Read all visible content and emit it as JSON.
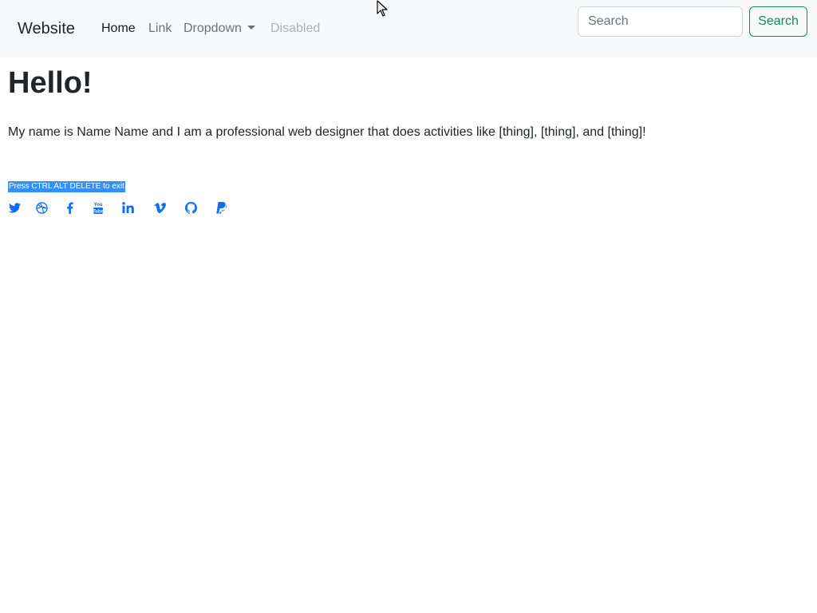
{
  "navbar": {
    "brand": "Website",
    "links": [
      "Home",
      "Link",
      "Dropdown",
      "Disabled"
    ],
    "search_placeholder": "Search",
    "search_button": "Search"
  },
  "main": {
    "heading": "Hello!",
    "intro": "My name is Name Name and I am a professional web designer that does activities like [thing], [thing], and [thing]!",
    "selected_text": "Press CTRL ALT DELETE to exit"
  },
  "social_icons": [
    "twitter-icon",
    "dribbble-icon",
    "facebook-icon",
    "youtube-icon",
    "linkedin-icon",
    "vimeo-icon",
    "github-icon",
    "paypal-icon"
  ],
  "colors": {
    "navbar_bg": "#f8f9fa",
    "link_blue": "#0d6efd",
    "success_green": "#198754",
    "selection": "#3390ff"
  }
}
